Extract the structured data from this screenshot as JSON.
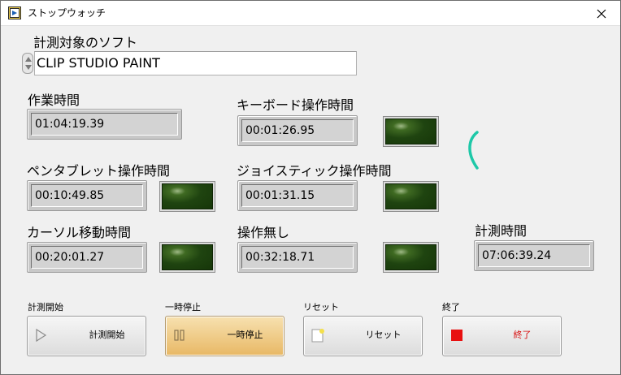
{
  "window": {
    "title": "ストップウォッチ"
  },
  "target_software": {
    "label": "計測対象のソフト",
    "value": "CLIP STUDIO PAINT"
  },
  "timers": {
    "work_time": {
      "label": "作業時間",
      "value": "01:04:19.39"
    },
    "keyboard": {
      "label": "キーボード操作時間",
      "value": "00:01:26.95"
    },
    "pen_tablet": {
      "label": "ペンタブレット操作時間",
      "value": "00:10:49.85"
    },
    "joystick": {
      "label": "ジョイスティック操作時間",
      "value": "00:01:31.15"
    },
    "cursor": {
      "label": "カーソル移動時間",
      "value": "00:20:01.27"
    },
    "no_operation": {
      "label": "操作無し",
      "value": "00:32:18.71"
    },
    "measure_time": {
      "label": "計測時間",
      "value": "07:06:39.24"
    }
  },
  "buttons": {
    "start": {
      "caption": "計測開始",
      "label": "計測開始"
    },
    "pause": {
      "caption": "一時停止",
      "label": "一時停止"
    },
    "reset": {
      "caption": "リセット",
      "label": "リセット"
    },
    "quit": {
      "caption": "終了",
      "label": "終了"
    }
  },
  "colors": {
    "accent_spinner": "#1ec8a8",
    "led_off": "#1f4410",
    "stop_red": "#d81010",
    "pause_orange": "#e8b865"
  }
}
